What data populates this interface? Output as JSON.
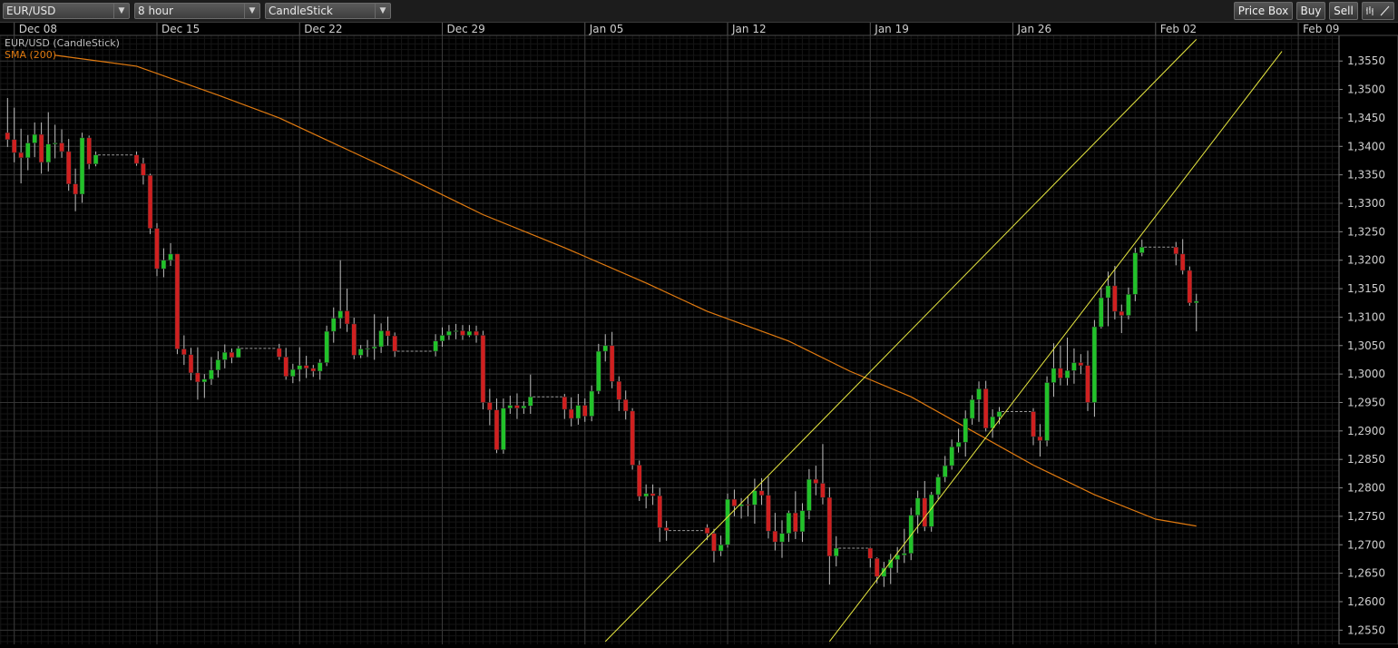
{
  "toolbar": {
    "symbol_select": "EUR/USD",
    "interval_select": "8 hour",
    "chart_type_select": "CandleStick",
    "price_box_label": "Price Box",
    "buy_label": "Buy",
    "sell_label": "Sell",
    "icons": [
      "bars-icon",
      "draw-line-icon"
    ]
  },
  "legend": {
    "main_series": "EUR/USD (CandleStick)",
    "indicator": "SMA (200)"
  },
  "colors": {
    "background": "#000000",
    "grid": "#2a2a2a",
    "up": "#22c22a",
    "down": "#d02020",
    "wick": "#bdbdbd",
    "sma": "#e07a10",
    "channel": "#e8e840",
    "axis_text": "#cfcfcf"
  },
  "chart_data": {
    "type": "candlestick",
    "title": "EUR/USD",
    "x_ticks": [
      "Dec 08",
      "Dec 15",
      "Dec 22",
      "Dec 29",
      "Jan 05",
      "Jan 12",
      "Jan 19",
      "Jan 26",
      "Feb 02",
      "Feb 09"
    ],
    "y_ticks": [
      "1,2550",
      "1,2600",
      "1,2650",
      "1,2700",
      "1,2750",
      "1,2800",
      "1,2850",
      "1,2900",
      "1,2950",
      "1,3000",
      "1,3050",
      "1,3100",
      "1,3150",
      "1,3200",
      "1,3250",
      "1,3300",
      "1,3350",
      "1,3400",
      "1,3450",
      "1,3500",
      "1,3550"
    ],
    "y_range": [
      1.2525,
      1.3595
    ],
    "x_range_days": [
      -7.7,
      58
    ],
    "grid": true,
    "candles": [
      {
        "t": -7.33,
        "o": 1.3424,
        "h": 1.3485,
        "l": 1.3399,
        "c": 1.3412
      },
      {
        "t": -7.0,
        "o": 1.3412,
        "h": 1.3468,
        "l": 1.3372,
        "c": 1.3389
      },
      {
        "t": -6.67,
        "o": 1.3389,
        "h": 1.3431,
        "l": 1.3335,
        "c": 1.338
      },
      {
        "t": -6.33,
        "o": 1.338,
        "h": 1.342,
        "l": 1.3358,
        "c": 1.3406
      },
      {
        "t": -6.0,
        "o": 1.3406,
        "h": 1.3442,
        "l": 1.3381,
        "c": 1.3421
      },
      {
        "t": -5.67,
        "o": 1.3421,
        "h": 1.3442,
        "l": 1.3352,
        "c": 1.3372
      },
      {
        "t": -5.33,
        "o": 1.3372,
        "h": 1.346,
        "l": 1.3356,
        "c": 1.3404
      },
      {
        "t": -5.0,
        "o": 1.3404,
        "h": 1.3438,
        "l": 1.3379,
        "c": 1.3406
      },
      {
        "t": -4.67,
        "o": 1.3406,
        "h": 1.343,
        "l": 1.338,
        "c": 1.3391
      },
      {
        "t": -4.33,
        "o": 1.3391,
        "h": 1.3413,
        "l": 1.3322,
        "c": 1.3334
      },
      {
        "t": -4.0,
        "o": 1.3334,
        "h": 1.3361,
        "l": 1.3286,
        "c": 1.3316
      },
      {
        "t": -3.67,
        "o": 1.3316,
        "h": 1.3424,
        "l": 1.3301,
        "c": 1.3415
      },
      {
        "t": -3.33,
        "o": 1.3415,
        "h": 1.3419,
        "l": 1.336,
        "c": 1.3369
      },
      {
        "t": -3.0,
        "o": 1.3369,
        "h": 1.3391,
        "l": 1.3365,
        "c": 1.3385
      },
      {
        "t": -1.0,
        "o": 1.3385,
        "h": 1.3391,
        "l": 1.3366,
        "c": 1.337
      },
      {
        "t": -0.67,
        "o": 1.337,
        "h": 1.338,
        "l": 1.3333,
        "c": 1.3349
      },
      {
        "t": -0.33,
        "o": 1.3349,
        "h": 1.3352,
        "l": 1.3246,
        "c": 1.3256
      },
      {
        "t": 0.0,
        "o": 1.3256,
        "h": 1.3265,
        "l": 1.3172,
        "c": 1.3185
      },
      {
        "t": 0.33,
        "o": 1.3185,
        "h": 1.3221,
        "l": 1.317,
        "c": 1.32
      },
      {
        "t": 0.67,
        "o": 1.32,
        "h": 1.323,
        "l": 1.319,
        "c": 1.3211
      },
      {
        "t": 1.0,
        "o": 1.3211,
        "h": 1.3211,
        "l": 1.3035,
        "c": 1.3044
      },
      {
        "t": 1.33,
        "o": 1.3044,
        "h": 1.3068,
        "l": 1.3016,
        "c": 1.3034
      },
      {
        "t": 1.67,
        "o": 1.3034,
        "h": 1.3046,
        "l": 1.2989,
        "c": 1.3002
      },
      {
        "t": 2.0,
        "o": 1.3002,
        "h": 1.3047,
        "l": 1.2955,
        "c": 1.2986
      },
      {
        "t": 2.33,
        "o": 1.2986,
        "h": 1.3,
        "l": 1.2958,
        "c": 1.2991
      },
      {
        "t": 2.67,
        "o": 1.2991,
        "h": 1.303,
        "l": 1.2981,
        "c": 1.3007
      },
      {
        "t": 3.0,
        "o": 1.3007,
        "h": 1.304,
        "l": 1.2994,
        "c": 1.3025
      },
      {
        "t": 3.33,
        "o": 1.3025,
        "h": 1.3052,
        "l": 1.301,
        "c": 1.3038
      },
      {
        "t": 3.67,
        "o": 1.3038,
        "h": 1.3045,
        "l": 1.3019,
        "c": 1.3029
      },
      {
        "t": 4.0,
        "o": 1.3029,
        "h": 1.3049,
        "l": 1.3035,
        "c": 1.3045
      },
      {
        "t": 6.0,
        "o": 1.3045,
        "h": 1.3053,
        "l": 1.3025,
        "c": 1.303
      },
      {
        "t": 6.33,
        "o": 1.303,
        "h": 1.3046,
        "l": 1.299,
        "c": 1.2996
      },
      {
        "t": 6.67,
        "o": 1.2996,
        "h": 1.3018,
        "l": 1.2984,
        "c": 1.3008
      },
      {
        "t": 7.0,
        "o": 1.3008,
        "h": 1.3047,
        "l": 1.2987,
        "c": 1.3015
      },
      {
        "t": 7.33,
        "o": 1.3015,
        "h": 1.3032,
        "l": 1.2993,
        "c": 1.301
      },
      {
        "t": 7.67,
        "o": 1.301,
        "h": 1.3016,
        "l": 1.2995,
        "c": 1.3005
      },
      {
        "t": 8.0,
        "o": 1.3005,
        "h": 1.3026,
        "l": 1.299,
        "c": 1.302
      },
      {
        "t": 8.33,
        "o": 1.302,
        "h": 1.3085,
        "l": 1.3014,
        "c": 1.3075
      },
      {
        "t": 8.67,
        "o": 1.3075,
        "h": 1.3117,
        "l": 1.3055,
        "c": 1.3098
      },
      {
        "t": 9.0,
        "o": 1.3098,
        "h": 1.32,
        "l": 1.308,
        "c": 1.3111
      },
      {
        "t": 9.33,
        "o": 1.3111,
        "h": 1.315,
        "l": 1.3074,
        "c": 1.3088
      },
      {
        "t": 9.67,
        "o": 1.3088,
        "h": 1.3099,
        "l": 1.3026,
        "c": 1.3033
      },
      {
        "t": 10.0,
        "o": 1.3033,
        "h": 1.3051,
        "l": 1.3028,
        "c": 1.3044
      },
      {
        "t": 10.33,
        "o": 1.3044,
        "h": 1.306,
        "l": 1.303,
        "c": 1.3045
      },
      {
        "t": 10.67,
        "o": 1.3045,
        "h": 1.3105,
        "l": 1.3025,
        "c": 1.3048
      },
      {
        "t": 11.0,
        "o": 1.3048,
        "h": 1.3089,
        "l": 1.3037,
        "c": 1.3076
      },
      {
        "t": 11.33,
        "o": 1.3076,
        "h": 1.3101,
        "l": 1.305,
        "c": 1.3067
      },
      {
        "t": 11.67,
        "o": 1.3067,
        "h": 1.3073,
        "l": 1.303,
        "c": 1.304
      },
      {
        "t": 13.67,
        "o": 1.304,
        "h": 1.307,
        "l": 1.3031,
        "c": 1.3058
      },
      {
        "t": 14.0,
        "o": 1.3058,
        "h": 1.3082,
        "l": 1.3048,
        "c": 1.3068
      },
      {
        "t": 14.33,
        "o": 1.3068,
        "h": 1.3086,
        "l": 1.306,
        "c": 1.3075
      },
      {
        "t": 14.67,
        "o": 1.3075,
        "h": 1.3088,
        "l": 1.3061,
        "c": 1.3076
      },
      {
        "t": 15.0,
        "o": 1.3076,
        "h": 1.3086,
        "l": 1.306,
        "c": 1.3068
      },
      {
        "t": 15.33,
        "o": 1.3068,
        "h": 1.3086,
        "l": 1.3065,
        "c": 1.3075
      },
      {
        "t": 15.67,
        "o": 1.3075,
        "h": 1.3085,
        "l": 1.3055,
        "c": 1.3068
      },
      {
        "t": 16.0,
        "o": 1.3068,
        "h": 1.3076,
        "l": 1.2938,
        "c": 1.295
      },
      {
        "t": 16.33,
        "o": 1.295,
        "h": 1.2974,
        "l": 1.291,
        "c": 1.2937
      },
      {
        "t": 16.67,
        "o": 1.2937,
        "h": 1.2957,
        "l": 1.2861,
        "c": 1.2867
      },
      {
        "t": 17.0,
        "o": 1.2867,
        "h": 1.2957,
        "l": 1.286,
        "c": 1.294
      },
      {
        "t": 17.33,
        "o": 1.294,
        "h": 1.2962,
        "l": 1.293,
        "c": 1.2945
      },
      {
        "t": 17.67,
        "o": 1.2945,
        "h": 1.2966,
        "l": 1.2921,
        "c": 1.294
      },
      {
        "t": 18.0,
        "o": 1.294,
        "h": 1.2952,
        "l": 1.293,
        "c": 1.2944
      },
      {
        "t": 18.33,
        "o": 1.2944,
        "h": 1.2999,
        "l": 1.293,
        "c": 1.296
      },
      {
        "t": 20.0,
        "o": 1.296,
        "h": 1.2965,
        "l": 1.2921,
        "c": 1.2938
      },
      {
        "t": 20.33,
        "o": 1.2938,
        "h": 1.2959,
        "l": 1.2908,
        "c": 1.2922
      },
      {
        "t": 20.67,
        "o": 1.2922,
        "h": 1.2965,
        "l": 1.2911,
        "c": 1.2945
      },
      {
        "t": 21.0,
        "o": 1.2945,
        "h": 1.2957,
        "l": 1.2916,
        "c": 1.2926
      },
      {
        "t": 21.33,
        "o": 1.2926,
        "h": 1.298,
        "l": 1.2917,
        "c": 1.297
      },
      {
        "t": 21.67,
        "o": 1.297,
        "h": 1.3053,
        "l": 1.2965,
        "c": 1.304
      },
      {
        "t": 22.0,
        "o": 1.304,
        "h": 1.307,
        "l": 1.3022,
        "c": 1.305
      },
      {
        "t": 22.33,
        "o": 1.305,
        "h": 1.3074,
        "l": 1.2975,
        "c": 1.2987
      },
      {
        "t": 22.67,
        "o": 1.2987,
        "h": 1.2996,
        "l": 1.2935,
        "c": 1.2955
      },
      {
        "t": 23.0,
        "o": 1.2955,
        "h": 1.2971,
        "l": 1.292,
        "c": 1.2935
      },
      {
        "t": 23.33,
        "o": 1.2935,
        "h": 1.294,
        "l": 1.2832,
        "c": 1.284
      },
      {
        "t": 23.67,
        "o": 1.284,
        "h": 1.2848,
        "l": 1.2777,
        "c": 1.2785
      },
      {
        "t": 24.0,
        "o": 1.2785,
        "h": 1.2806,
        "l": 1.2764,
        "c": 1.279
      },
      {
        "t": 24.33,
        "o": 1.279,
        "h": 1.2806,
        "l": 1.277,
        "c": 1.2786
      },
      {
        "t": 24.67,
        "o": 1.2786,
        "h": 1.28,
        "l": 1.2705,
        "c": 1.273
      },
      {
        "t": 25.0,
        "o": 1.273,
        "h": 1.2742,
        "l": 1.2707,
        "c": 1.2725
      },
      {
        "t": 27.0,
        "o": 1.273,
        "h": 1.2736,
        "l": 1.2708,
        "c": 1.272
      },
      {
        "t": 27.33,
        "o": 1.272,
        "h": 1.2728,
        "l": 1.2669,
        "c": 1.2689
      },
      {
        "t": 27.67,
        "o": 1.2689,
        "h": 1.2716,
        "l": 1.268,
        "c": 1.27
      },
      {
        "t": 28.0,
        "o": 1.27,
        "h": 1.279,
        "l": 1.2695,
        "c": 1.278
      },
      {
        "t": 28.33,
        "o": 1.278,
        "h": 1.2797,
        "l": 1.275,
        "c": 1.2768
      },
      {
        "t": 28.67,
        "o": 1.2768,
        "h": 1.2782,
        "l": 1.2746,
        "c": 1.2771
      },
      {
        "t": 29.0,
        "o": 1.2771,
        "h": 1.2785,
        "l": 1.275,
        "c": 1.277
      },
      {
        "t": 29.33,
        "o": 1.277,
        "h": 1.2816,
        "l": 1.2737,
        "c": 1.2795
      },
      {
        "t": 29.67,
        "o": 1.2795,
        "h": 1.2817,
        "l": 1.277,
        "c": 1.2787
      },
      {
        "t": 30.0,
        "o": 1.2787,
        "h": 1.282,
        "l": 1.2711,
        "c": 1.2724
      },
      {
        "t": 30.33,
        "o": 1.2724,
        "h": 1.2756,
        "l": 1.269,
        "c": 1.2705
      },
      {
        "t": 30.67,
        "o": 1.2705,
        "h": 1.2743,
        "l": 1.2677,
        "c": 1.272
      },
      {
        "t": 31.0,
        "o": 1.272,
        "h": 1.276,
        "l": 1.2705,
        "c": 1.2756
      },
      {
        "t": 31.33,
        "o": 1.2756,
        "h": 1.2794,
        "l": 1.271,
        "c": 1.2723
      },
      {
        "t": 31.67,
        "o": 1.2723,
        "h": 1.2773,
        "l": 1.2705,
        "c": 1.276
      },
      {
        "t": 32.0,
        "o": 1.276,
        "h": 1.2833,
        "l": 1.2745,
        "c": 1.2815
      },
      {
        "t": 32.33,
        "o": 1.2815,
        "h": 1.2839,
        "l": 1.2787,
        "c": 1.2808
      },
      {
        "t": 32.67,
        "o": 1.2808,
        "h": 1.2877,
        "l": 1.2771,
        "c": 1.2783
      },
      {
        "t": 33.0,
        "o": 1.2783,
        "h": 1.2801,
        "l": 1.263,
        "c": 1.268
      },
      {
        "t": 33.33,
        "o": 1.268,
        "h": 1.2715,
        "l": 1.2662,
        "c": 1.2694
      },
      {
        "t": 35.0,
        "o": 1.2694,
        "h": 1.2695,
        "l": 1.266,
        "c": 1.2676
      },
      {
        "t": 35.33,
        "o": 1.2676,
        "h": 1.2678,
        "l": 1.2632,
        "c": 1.2644
      },
      {
        "t": 35.67,
        "o": 1.2644,
        "h": 1.267,
        "l": 1.2626,
        "c": 1.2659
      },
      {
        "t": 36.0,
        "o": 1.2659,
        "h": 1.2684,
        "l": 1.2631,
        "c": 1.2674
      },
      {
        "t": 36.33,
        "o": 1.2674,
        "h": 1.2696,
        "l": 1.2651,
        "c": 1.2682
      },
      {
        "t": 36.67,
        "o": 1.2682,
        "h": 1.2728,
        "l": 1.2668,
        "c": 1.2685
      },
      {
        "t": 37.0,
        "o": 1.2685,
        "h": 1.2765,
        "l": 1.2673,
        "c": 1.2752
      },
      {
        "t": 37.33,
        "o": 1.2752,
        "h": 1.2795,
        "l": 1.272,
        "c": 1.2782
      },
      {
        "t": 37.67,
        "o": 1.2782,
        "h": 1.2812,
        "l": 1.2724,
        "c": 1.2732
      },
      {
        "t": 38.0,
        "o": 1.2732,
        "h": 1.2793,
        "l": 1.2723,
        "c": 1.2788
      },
      {
        "t": 38.33,
        "o": 1.2788,
        "h": 1.2824,
        "l": 1.278,
        "c": 1.2819
      },
      {
        "t": 38.67,
        "o": 1.2819,
        "h": 1.2856,
        "l": 1.281,
        "c": 1.2839
      },
      {
        "t": 39.0,
        "o": 1.2839,
        "h": 1.2885,
        "l": 1.2832,
        "c": 1.2872
      },
      {
        "t": 39.33,
        "o": 1.2872,
        "h": 1.2904,
        "l": 1.2862,
        "c": 1.288
      },
      {
        "t": 39.67,
        "o": 1.288,
        "h": 1.2936,
        "l": 1.2855,
        "c": 1.2922
      },
      {
        "t": 40.0,
        "o": 1.2922,
        "h": 1.2963,
        "l": 1.2911,
        "c": 1.2955
      },
      {
        "t": 40.33,
        "o": 1.2955,
        "h": 1.2987,
        "l": 1.2916,
        "c": 1.2974
      },
      {
        "t": 40.67,
        "o": 1.2974,
        "h": 1.2988,
        "l": 1.2899,
        "c": 1.2905
      },
      {
        "t": 41.0,
        "o": 1.2905,
        "h": 1.2938,
        "l": 1.2888,
        "c": 1.2925
      },
      {
        "t": 41.33,
        "o": 1.2925,
        "h": 1.2942,
        "l": 1.2912,
        "c": 1.2934
      },
      {
        "t": 43.0,
        "o": 1.2934,
        "h": 1.294,
        "l": 1.2875,
        "c": 1.289
      },
      {
        "t": 43.33,
        "o": 1.289,
        "h": 1.2912,
        "l": 1.2855,
        "c": 1.2883
      },
      {
        "t": 43.67,
        "o": 1.2883,
        "h": 1.2996,
        "l": 1.2873,
        "c": 1.2985
      },
      {
        "t": 44.0,
        "o": 1.2985,
        "h": 1.3054,
        "l": 1.296,
        "c": 1.301
      },
      {
        "t": 44.33,
        "o": 1.301,
        "h": 1.305,
        "l": 1.298,
        "c": 1.2993
      },
      {
        "t": 44.67,
        "o": 1.2993,
        "h": 1.3064,
        "l": 1.298,
        "c": 1.3006
      },
      {
        "t": 45.0,
        "o": 1.3006,
        "h": 1.3045,
        "l": 1.2983,
        "c": 1.302
      },
      {
        "t": 45.33,
        "o": 1.302,
        "h": 1.3035,
        "l": 1.3,
        "c": 1.3015
      },
      {
        "t": 45.67,
        "o": 1.3015,
        "h": 1.3041,
        "l": 1.2935,
        "c": 1.295
      },
      {
        "t": 46.0,
        "o": 1.295,
        "h": 1.3095,
        "l": 1.2925,
        "c": 1.3083
      },
      {
        "t": 46.33,
        "o": 1.3083,
        "h": 1.3151,
        "l": 1.308,
        "c": 1.3134
      },
      {
        "t": 46.67,
        "o": 1.3134,
        "h": 1.318,
        "l": 1.3084,
        "c": 1.3155
      },
      {
        "t": 47.0,
        "o": 1.3155,
        "h": 1.319,
        "l": 1.3096,
        "c": 1.311
      },
      {
        "t": 47.33,
        "o": 1.311,
        "h": 1.3122,
        "l": 1.3072,
        "c": 1.3103
      },
      {
        "t": 47.67,
        "o": 1.3103,
        "h": 1.3152,
        "l": 1.3096,
        "c": 1.314
      },
      {
        "t": 48.0,
        "o": 1.314,
        "h": 1.3222,
        "l": 1.3128,
        "c": 1.3213
      },
      {
        "t": 48.33,
        "o": 1.3213,
        "h": 1.3236,
        "l": 1.3207,
        "c": 1.3223
      },
      {
        "t": 50.0,
        "o": 1.3223,
        "h": 1.3232,
        "l": 1.3191,
        "c": 1.3211
      },
      {
        "t": 50.33,
        "o": 1.3211,
        "h": 1.3237,
        "l": 1.3175,
        "c": 1.3182
      },
      {
        "t": 50.67,
        "o": 1.3182,
        "h": 1.3189,
        "l": 1.312,
        "c": 1.3125
      },
      {
        "t": 51.0,
        "o": 1.3125,
        "h": 1.3141,
        "l": 1.3075,
        "c": 1.3128
      }
    ],
    "sma_200": {
      "name": "SMA (200)",
      "points": [
        [
          -5.0,
          1.356
        ],
        [
          -1.0,
          1.3541
        ],
        [
          3.0,
          1.349
        ],
        [
          6.0,
          1.345
        ],
        [
          9.0,
          1.34
        ],
        [
          12.0,
          1.335
        ],
        [
          16.0,
          1.328
        ],
        [
          20.0,
          1.3222
        ],
        [
          24.0,
          1.316
        ],
        [
          27.0,
          1.311
        ],
        [
          31.0,
          1.3058
        ],
        [
          34.0,
          1.3005
        ],
        [
          37.0,
          1.296
        ],
        [
          40.0,
          1.29
        ],
        [
          43.0,
          1.284
        ],
        [
          46.0,
          1.2788
        ],
        [
          49.0,
          1.2745
        ],
        [
          51.0,
          1.2733
        ]
      ]
    },
    "channel_lines": [
      {
        "name": "upper",
        "points": [
          [
            22.0,
            1.253
          ],
          [
            51.0,
            1.3588
          ]
        ]
      },
      {
        "name": "lower",
        "points": [
          [
            33.0,
            1.253
          ],
          [
            55.2,
            1.3567
          ]
        ]
      }
    ]
  }
}
